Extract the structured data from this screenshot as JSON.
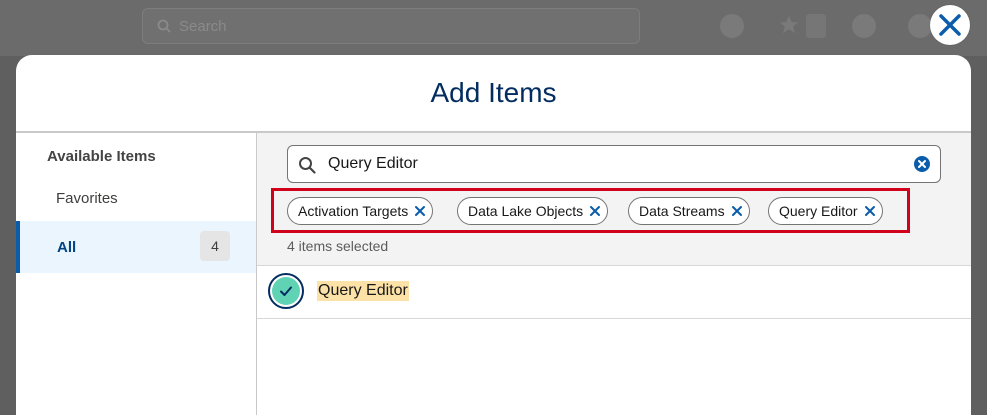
{
  "background": {
    "search_placeholder": "Search"
  },
  "modal": {
    "title": "Add Items",
    "close_label": "Close"
  },
  "sidebar": {
    "heading": "Available Items",
    "items": [
      {
        "label": "Favorites"
      },
      {
        "label": "All",
        "count": "4"
      }
    ]
  },
  "search": {
    "value": "Query Editor"
  },
  "pills": [
    {
      "label": "Activation Targets"
    },
    {
      "label": "Data Lake Objects"
    },
    {
      "label": "Data Streams"
    },
    {
      "label": "Query Editor"
    }
  ],
  "selected_count_text": "4 items selected",
  "results": [
    {
      "label": "Query Editor",
      "selected": true
    }
  ],
  "colors": {
    "brand_dark": "#032d60",
    "accent_blue": "#0b5cab",
    "highlight_red": "#d0021b",
    "check_green": "#5fd3b4",
    "match_highlight": "#fde2a7"
  }
}
